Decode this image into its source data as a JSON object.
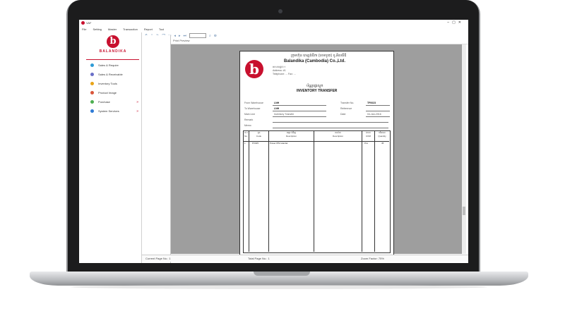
{
  "app": {
    "title": "VAF",
    "menu": [
      "File",
      "Setting",
      "Master",
      "Transaction",
      "Report",
      "Tool"
    ],
    "window_controls": [
      "–",
      "▢",
      "✕"
    ]
  },
  "sidebar": {
    "brand_letter": "b",
    "brand_name": "BALANDIKA",
    "items": [
      {
        "label": "Sales & Require",
        "color": "#2e9bd6",
        "icon": "sales-icon"
      },
      {
        "label": "Sales & Receivable",
        "color": "#6a6fc8",
        "icon": "receivable-icon"
      },
      {
        "label": "Inventory Tools",
        "color": "#e8a317",
        "icon": "inventory-icon"
      },
      {
        "label": "Product Image",
        "color": "#d9553a",
        "icon": "image-icon"
      },
      {
        "label": "Purchase",
        "color": "#4caf50",
        "icon": "purchase-icon",
        "arrow": "»"
      },
      {
        "label": "System Services",
        "color": "#2e7bd6",
        "icon": "services-icon",
        "arrow": "»"
      }
    ]
  },
  "viewer": {
    "tab_label": "Print Preview",
    "status_left": "Current Page No.: 1",
    "status_mid": "Total Page No.: 1",
    "status_right": "Zoom Factor: 75%"
  },
  "report": {
    "logo_letter": "b",
    "company_khmer": "ក្រុមហ៊ុន បាឡង់ឌីកា (ខេមបូឌា) ខូ.អិលធីឌី",
    "company": "Balandika (Cambodia) Co.,Ltd.",
    "address_1": "អាសយដ្ឋាន ៖",
    "address_2": "Address: #1",
    "address_3": "Telephone: ... Fax: ...",
    "title_khmer": "ប័ណ្ណផ្ទេរស្តុក",
    "title": "INVENTORY TRANSFER",
    "fields": {
      "from_warehouse_label": "From Warehouse",
      "from_warehouse_value": "LNH",
      "to_warehouse_label": "To Warehouse",
      "to_warehouse_value": "LNH",
      "from_line_label": "Main Line",
      "from_line_value": "Inventory Transfer",
      "transfer_no_label": "Transfer No.",
      "transfer_no_value": "TF0023",
      "reference_label": "Reference",
      "date_label": "Date",
      "date_value": "04-Jan-2016",
      "remark_label": "Remark",
      "memo_label": "Memo"
    },
    "columns": [
      {
        "kh": "ល.រ",
        "en": "No."
      },
      {
        "kh": "កូដ",
        "en": "Code"
      },
      {
        "kh": "ឈ្មោះទំនិញ",
        "en": "Description"
      },
      {
        "kh": "ពណ៌នា",
        "en": "Description"
      },
      {
        "kh": "ឯកតា",
        "en": "UOM"
      },
      {
        "kh": "បរិមាណ",
        "en": "Quantity"
      }
    ],
    "rows": [
      {
        "no": "1",
        "code": "PV025",
        "name": "Power IPM standar",
        "desc": "",
        "uom": "Pcs",
        "qty": "45"
      }
    ]
  }
}
